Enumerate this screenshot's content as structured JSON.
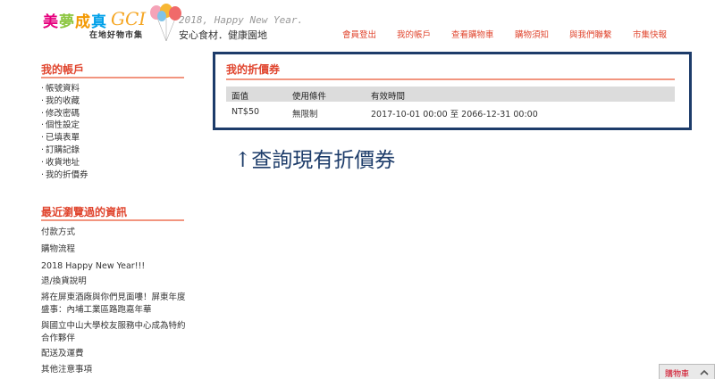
{
  "header": {
    "logo": {
      "chars": [
        "美",
        "夢",
        "成",
        "真"
      ],
      "gci": "GCI",
      "sub": "在地好物市集"
    },
    "slogan_en": "2018, Happy New Year.",
    "slogan_ch": "安心食材．健康園地",
    "nav": [
      "會員登出",
      "我的帳戶",
      "查看購物車",
      "購物須知",
      "與我們聯繫",
      "市集快報"
    ]
  },
  "sidebar": {
    "account_title": "我的帳戶",
    "account_items": [
      "帳號資料",
      "我的收藏",
      "修改密碼",
      "個性設定",
      "已填表單",
      "訂購記錄",
      "收貨地址",
      "我的折價券"
    ],
    "recent_title": "最近瀏覽過的資訊",
    "recent_items": [
      "付款方式",
      "購物流程",
      "2018 Happy New Year!!!",
      "退/換貨說明",
      "將在屏東酒廠與你們見面嘍！屏東年度盛事：內埔工業區路跑嘉年華",
      "與國立中山大學校友服務中心成為特約合作夥伴",
      "配送及運費",
      "其他注意事項"
    ]
  },
  "coupons": {
    "title": "我的折價券",
    "columns": [
      "面值",
      "使用條件",
      "有效時間"
    ],
    "rows": [
      {
        "value": "NT$50",
        "condition": "無限制",
        "validity": "2017-10-01 00:00 至 2066-12-31 00:00"
      }
    ]
  },
  "annotation": "↑查詢現有折價券",
  "cart": {
    "label": "購物車",
    "icon": "collapse-arrow-icon"
  },
  "colors": {
    "accent": "#e0452e",
    "rule": "#f2957f",
    "panel_border": "#1d3c6a",
    "annotation": "#1d3c6a"
  }
}
